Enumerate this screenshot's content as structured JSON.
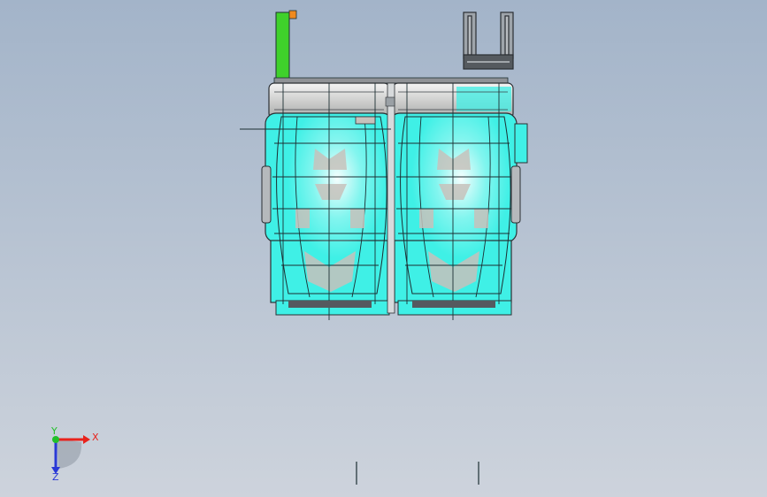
{
  "viewport": {
    "background_top": "#a3b4c9",
    "background_bottom": "#cdd3dc"
  },
  "model": {
    "body_color": "#3ff0e6",
    "mesh_color": "#1c2e32",
    "grey_color": "#c7c2bc",
    "handle_green": "#3fd12b",
    "handle_orange": "#f08a1e"
  },
  "triad": {
    "x_label": "X",
    "y_label": "Y",
    "z_label": "Z",
    "x_color": "#e8221c",
    "y_color": "#22c02a",
    "z_color": "#2a39d6"
  }
}
